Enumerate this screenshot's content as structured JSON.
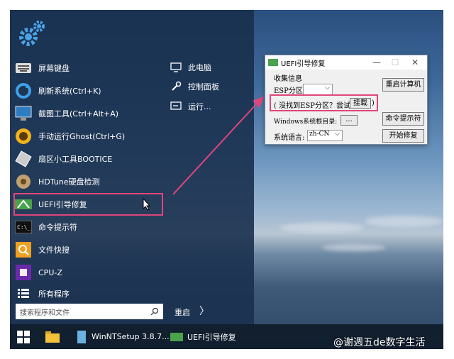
{
  "start_menu": {
    "left_items": [
      {
        "label": "屏幕键盘",
        "icon": "keyboard-icon"
      },
      {
        "label": "刷新系统(Ctrl+K)",
        "icon": "refresh-icon"
      },
      {
        "label": "截图工具(Ctrl+Alt+A)",
        "icon": "screenshot-icon"
      },
      {
        "label": "手动运行Ghost(Ctrl+G)",
        "icon": "ghost-icon"
      },
      {
        "label": "扇区小工具BOOTICE",
        "icon": "bootice-icon"
      },
      {
        "label": "HDTune硬盘检测",
        "icon": "hdtune-icon"
      },
      {
        "label": "UEFI引导修复",
        "icon": "uefi-repair-icon"
      },
      {
        "label": "命令提示符",
        "icon": "cmd-icon"
      },
      {
        "label": "文件快搜",
        "icon": "file-search-icon"
      },
      {
        "label": "CPU-Z",
        "icon": "cpuz-icon"
      },
      {
        "label": "所有程序",
        "icon": "all-programs-icon"
      }
    ],
    "right_items": [
      {
        "label": "此电脑",
        "icon": "computer-icon"
      },
      {
        "label": "控制面板",
        "icon": "wrench-icon"
      },
      {
        "label": "运行...",
        "icon": "run-icon"
      }
    ],
    "search_placeholder": "搜索程序和文件",
    "restart_label": "重启",
    "restart_arrow": "〉"
  },
  "taskbar": {
    "items": [
      {
        "label": "WinNTSetup 3.8.7...",
        "icon": "winntsetup-icon"
      },
      {
        "label": "UEFI引导修复",
        "icon": "uefi-repair-icon"
      }
    ]
  },
  "dialog": {
    "title": "UEFI引导修复",
    "minimize": "—",
    "maximize": "☐",
    "close": "✕",
    "group_label": "收集信息",
    "esp_label": "ESP分区:",
    "esp_value": "",
    "not_found_text": "( 没找到ESP分区？尝试",
    "mount_button": "挂载",
    "not_found_close": ")",
    "windows_root_label": "Windows系统根目录:",
    "browse_button": "...",
    "language_label": "系统语言:",
    "language_value": "zh-CN",
    "restart_button": "重启计算机",
    "cmd_button": "命令提示符",
    "start_repair_button": "开始修复"
  },
  "watermark": "@谢週五de数字生活",
  "colors": {
    "highlight": "#e0457b",
    "menu_bg": "#1a304e",
    "taskbar_bg": "#101c2c"
  }
}
